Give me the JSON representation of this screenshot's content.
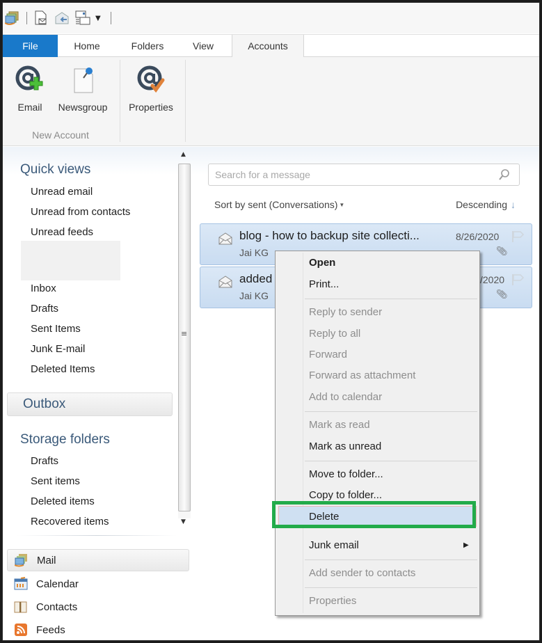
{
  "quick_access": {
    "icons": [
      "mail-app-icon",
      "new-message-icon",
      "send-receive-icon",
      "view-layout-icon",
      "customize-dropdown-icon"
    ]
  },
  "tabs": [
    {
      "label": "File",
      "active": false,
      "accent": "#1979ca"
    },
    {
      "label": "Home",
      "active": false
    },
    {
      "label": "Folders",
      "active": false
    },
    {
      "label": "View",
      "active": false
    },
    {
      "label": "Accounts",
      "active": true
    }
  ],
  "ribbon": {
    "groups": [
      {
        "label": "New Account",
        "buttons": [
          {
            "label": "Email",
            "icon": "at-plus-icon"
          },
          {
            "label": "Newsgroup",
            "icon": "newsgroup-pin-icon"
          }
        ]
      },
      {
        "label": "",
        "buttons": [
          {
            "label": "Properties",
            "icon": "at-check-icon"
          }
        ]
      }
    ]
  },
  "nav": {
    "quick_views": {
      "header": "Quick views",
      "items": [
        "Unread email",
        "Unread from contacts",
        "Unread feeds"
      ]
    },
    "account_folders": [
      "Inbox",
      "Drafts",
      "Sent Items",
      "Junk E-mail",
      "Deleted Items"
    ],
    "outbox": "Outbox",
    "storage": {
      "header": "Storage folders",
      "items": [
        "Drafts",
        "Sent items",
        "Deleted items",
        "Recovered items"
      ]
    },
    "bottom": [
      {
        "label": "Mail",
        "icon": "mail-icon",
        "active": true
      },
      {
        "label": "Calendar",
        "icon": "calendar-icon",
        "active": false
      },
      {
        "label": "Contacts",
        "icon": "contacts-icon",
        "active": false
      },
      {
        "label": "Feeds",
        "icon": "rss-feed-icon",
        "active": false
      }
    ]
  },
  "message_list": {
    "search_placeholder": "Search for a message",
    "sort_label": "Sort by sent (Conversations)",
    "order_label": "Descending",
    "messages": [
      {
        "subject": "blog - how to backup site collecti...",
        "from": "Jai KG",
        "date": "8/26/2020",
        "has_attachment": true
      },
      {
        "subject": "added",
        "from": "Jai KG",
        "date": "/2020",
        "has_attachment": true
      }
    ]
  },
  "context_menu": {
    "items": [
      {
        "label": "Open",
        "bold": true,
        "disabled": false
      },
      {
        "label": "Print...",
        "disabled": false
      },
      {
        "label": "Reply to sender",
        "disabled": true
      },
      {
        "label": "Reply to all",
        "disabled": true
      },
      {
        "label": "Forward",
        "disabled": true
      },
      {
        "label": "Forward as attachment",
        "disabled": true
      },
      {
        "label": "Add to calendar",
        "disabled": true
      },
      {
        "label": "Mark as read",
        "disabled": true
      },
      {
        "label": "Mark as unread",
        "disabled": false
      },
      {
        "label": "Move to folder...",
        "disabled": false
      },
      {
        "label": "Copy to folder...",
        "disabled": false
      },
      {
        "label": "Delete",
        "disabled": false,
        "highlighted": true
      },
      {
        "label": "Junk email",
        "disabled": false,
        "submenu": true
      },
      {
        "label": "Add sender to contacts",
        "disabled": true
      },
      {
        "label": "Properties",
        "disabled": true
      }
    ],
    "annotation_color": "#22ab4a",
    "highlight_color": "#cfe0f2"
  }
}
